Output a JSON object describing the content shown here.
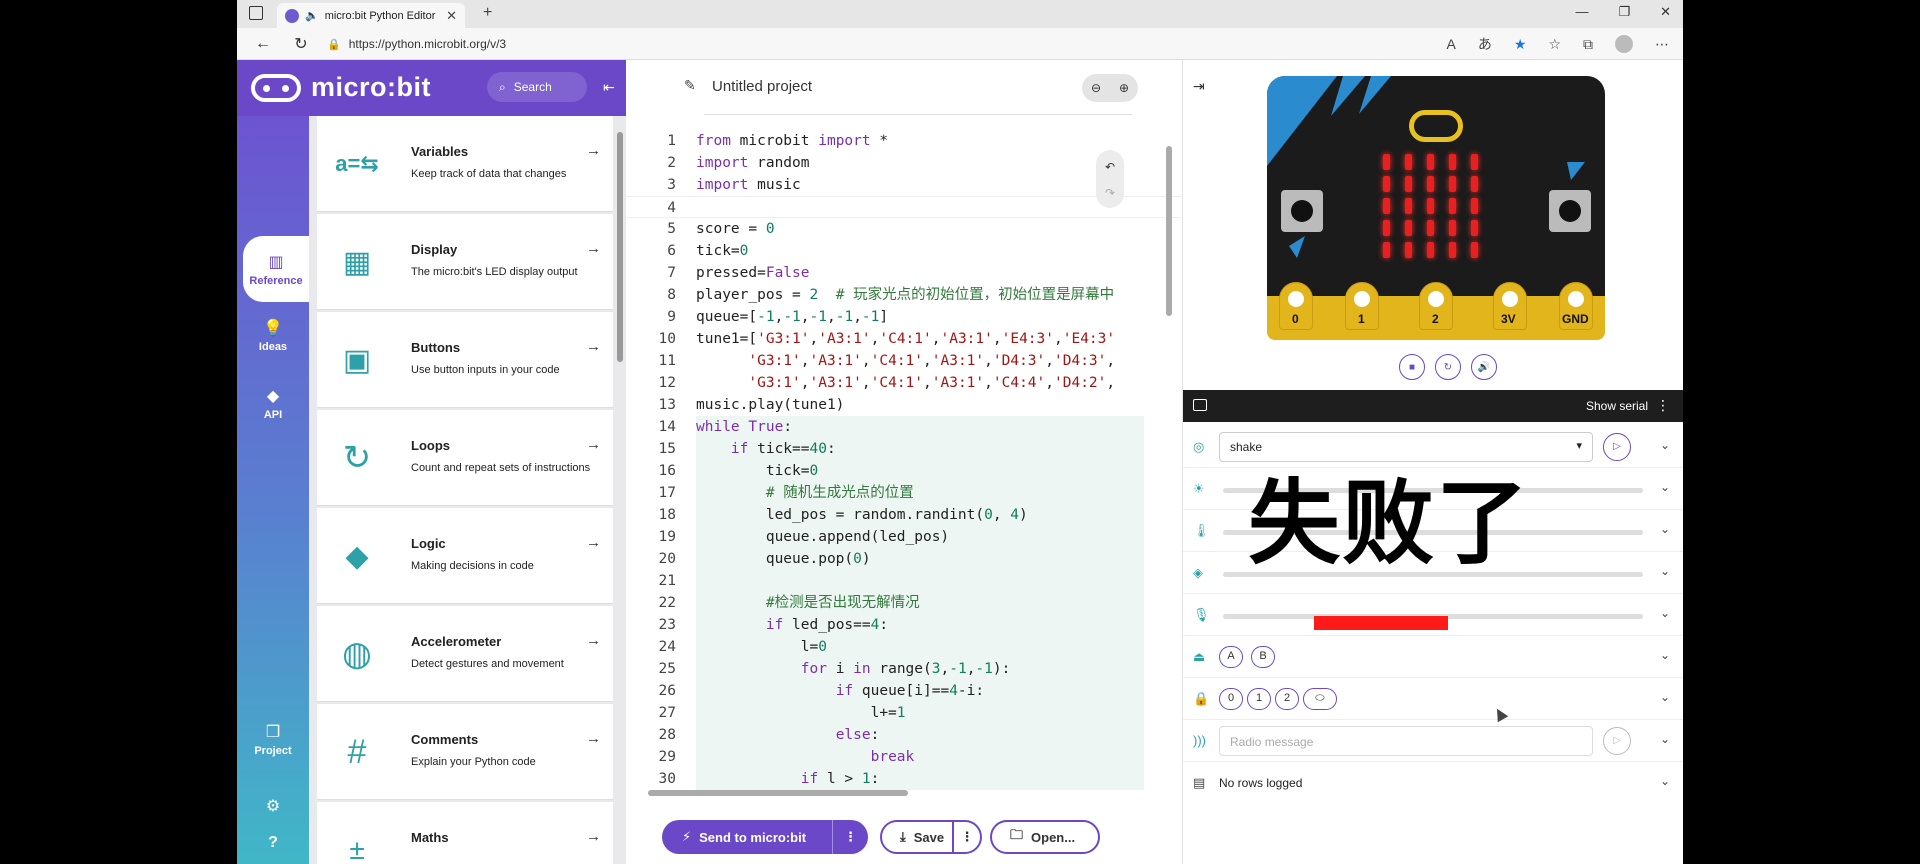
{
  "browser": {
    "tab_title": "micro:bit Python Editor",
    "url": "https://python.microbit.org/v/3"
  },
  "brand": {
    "logo_text": "micro:bit",
    "search_label": "Search"
  },
  "leftnav": {
    "items": [
      {
        "label": "Reference",
        "icon": "book-icon"
      },
      {
        "label": "Ideas",
        "icon": "lightbulb-icon"
      },
      {
        "label": "API",
        "icon": "python-icon"
      },
      {
        "label": "Project",
        "icon": "files-icon"
      }
    ]
  },
  "reference": [
    {
      "name": "Variables",
      "desc": "Keep track of data that changes"
    },
    {
      "name": "Display",
      "desc": "The micro:bit's LED display output"
    },
    {
      "name": "Buttons",
      "desc": "Use button inputs in your code"
    },
    {
      "name": "Loops",
      "desc": "Count and repeat sets of instructions"
    },
    {
      "name": "Logic",
      "desc": "Making decisions in code"
    },
    {
      "name": "Accelerometer",
      "desc": "Detect gestures and movement"
    },
    {
      "name": "Comments",
      "desc": "Explain your Python code"
    },
    {
      "name": "Maths",
      "desc": ""
    }
  ],
  "editor": {
    "project_name": "Untitled project",
    "lines": [
      "from microbit import *",
      "import random",
      "import music",
      "",
      "score = 0",
      "tick=0",
      "pressed=False",
      "player_pos = 2  # 玩家光点的初始位置，初始位置是屏幕中",
      "queue=[-1,-1,-1,-1,-1]",
      "tune1=['G3:1','A3:1','C4:1','A3:1','E4:3','E4:3'",
      "      'G3:1','A3:1','C4:1','A3:1','D4:3','D4:3',",
      "      'G3:1','A3:1','C4:1','A3:1','C4:4','D4:2',",
      "music.play(tune1)",
      "while True:",
      "    if tick==40:",
      "        tick=0",
      "        # 随机生成光点的位置",
      "        led_pos = random.randint(0, 4)",
      "        queue.append(led_pos)",
      "        queue.pop(0)",
      "",
      "        #检测是否出现无解情况",
      "        if led_pos==4:",
      "            l=0",
      "            for i in range(3,-1,-1):",
      "                if queue[i]==4-i:",
      "                    l+=1",
      "                else:",
      "                    break",
      "            if l > 1:"
    ],
    "send_label": "Send to micro:bit",
    "save_label": "Save",
    "open_label": "Open..."
  },
  "simulator": {
    "pin_labels": [
      "0",
      "1",
      "2",
      "3V",
      "GND"
    ],
    "show_serial_label": "Show serial",
    "gesture_value": "shake",
    "button_labels": [
      "A",
      "B"
    ],
    "touch_labels": [
      "0",
      "1",
      "2"
    ],
    "radio_placeholder": "Radio message",
    "data_log_status": "No rows logged",
    "sound_level": 0.32
  },
  "overlay_text": "失败了",
  "colors": {
    "accent": "#6a48c8",
    "led": "#e82020",
    "board_edge": "#e2b51c",
    "sensor_icon": "#2ea1a8"
  }
}
